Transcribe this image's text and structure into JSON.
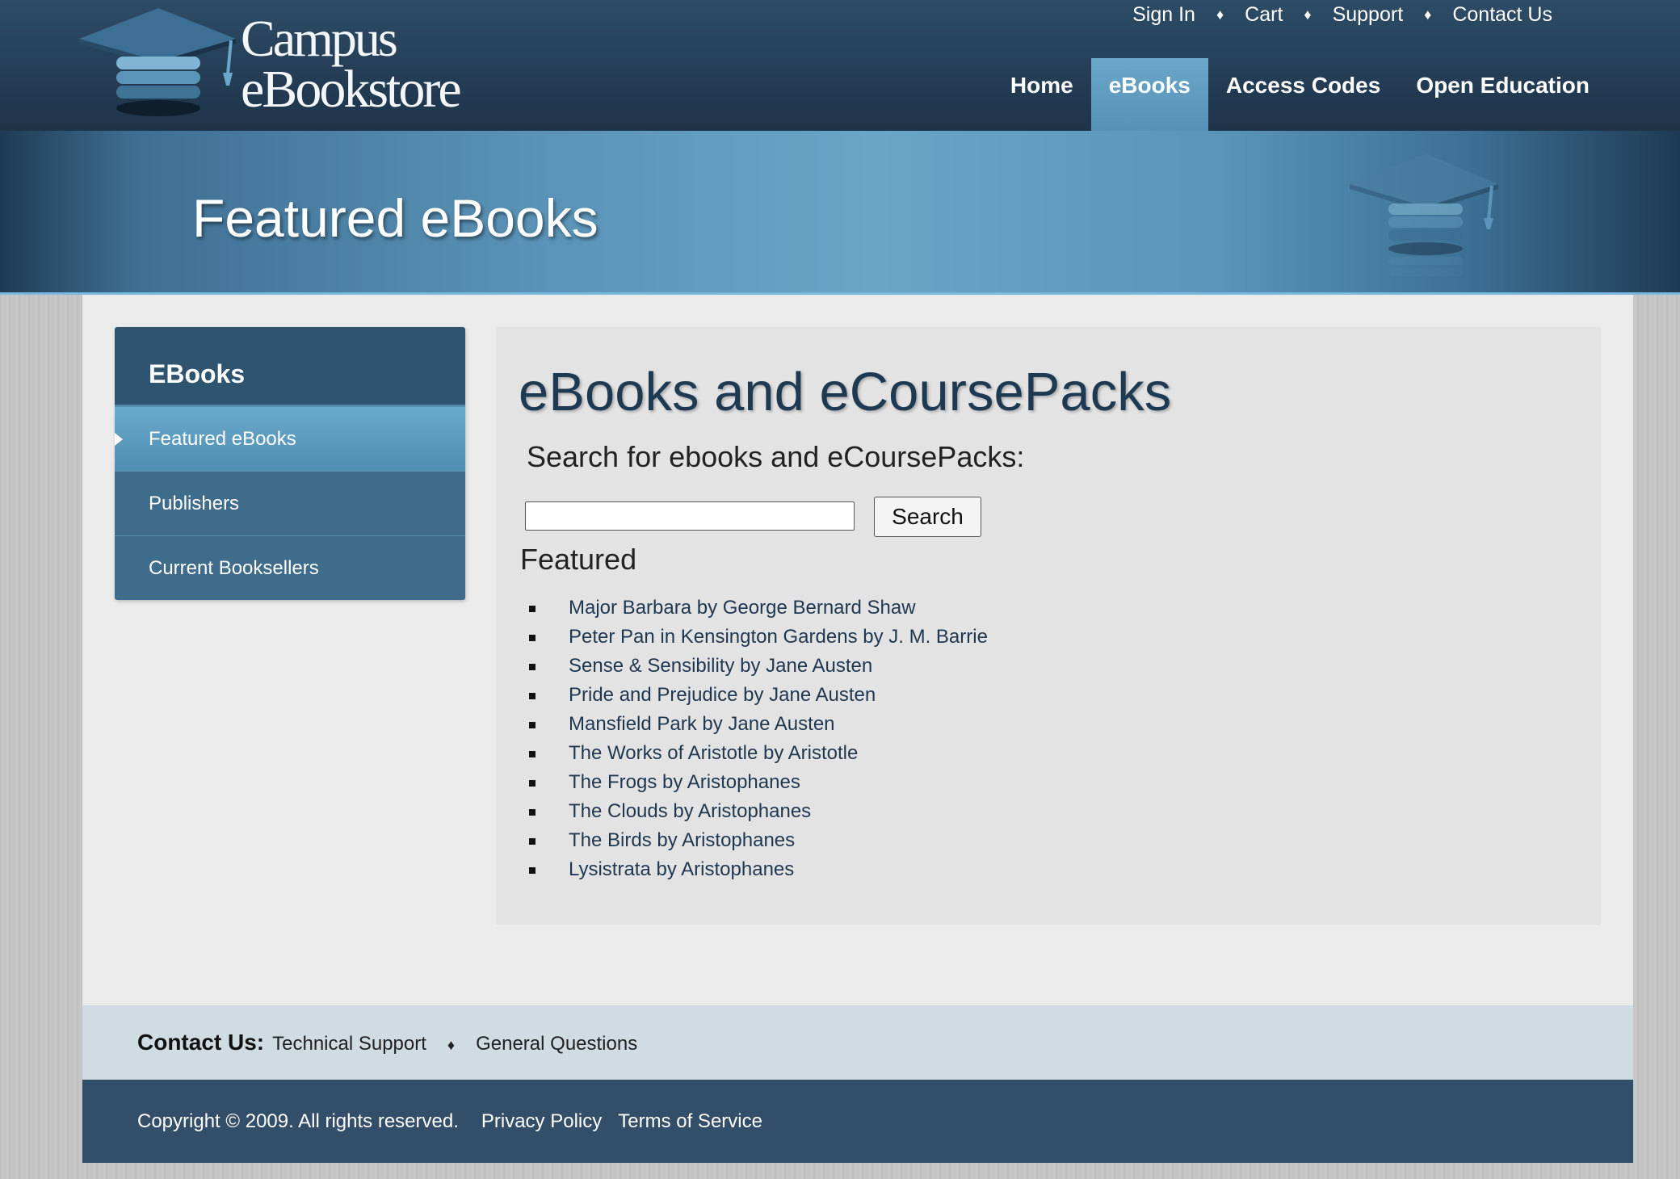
{
  "header": {
    "logo_line1": "Campus",
    "logo_line2": "eBookstore",
    "utility_links": [
      "Sign In",
      "Cart",
      "Support",
      "Contact Us"
    ],
    "utility_separator": "♦",
    "nav": [
      {
        "label": "Home",
        "active": false
      },
      {
        "label": "eBooks",
        "active": true
      },
      {
        "label": "Access Codes",
        "active": false
      },
      {
        "label": "Open Education",
        "active": false
      }
    ]
  },
  "banner": {
    "title": "Featured eBooks"
  },
  "sidebar": {
    "heading": "EBooks",
    "items": [
      {
        "label": "Featured eBooks",
        "active": true
      },
      {
        "label": "Publishers",
        "active": false
      },
      {
        "label": "Current Booksellers",
        "active": false
      }
    ]
  },
  "main": {
    "title": "eBooks and eCoursePacks",
    "search_label": "Search for ebooks and eCoursePacks:",
    "search_value": "",
    "search_button": "Search",
    "featured_heading": "Featured",
    "featured": [
      "Major Barbara by George Bernard Shaw",
      "Peter Pan in Kensington Gardens by J. M. Barrie",
      "Sense & Sensibility by Jane Austen",
      "Pride and Prejudice by Jane Austen",
      "Mansfield Park by Jane Austen",
      "The Works of Aristotle by Aristotle",
      "The Frogs by Aristophanes",
      "The Clouds by Aristophanes",
      "The Birds by Aristophanes",
      "Lysistrata by Aristophanes"
    ]
  },
  "footer": {
    "contact_label": "Contact Us:",
    "contact_links": [
      "Technical Support",
      "General Questions"
    ],
    "separator": "♦",
    "copyright": "Copyright © 2009. All rights reserved.",
    "legal_links": [
      "Privacy Policy",
      "Terms of Service"
    ]
  },
  "colors": {
    "header_bg": "#243e56",
    "nav_active": "#5f9cc0",
    "sidebar_head": "#2e5470",
    "sidebar_item": "#3f6c8a",
    "title_text": "#1e3a52",
    "footer_bg": "#324e68"
  },
  "icons": {
    "logo": "graduation-cap-book-stack-icon",
    "banner": "graduation-cap-book-stack-icon",
    "separator": "diamond-icon",
    "list_bullet": "square-bullet-icon",
    "active_pointer": "triangle-pointer-icon"
  }
}
